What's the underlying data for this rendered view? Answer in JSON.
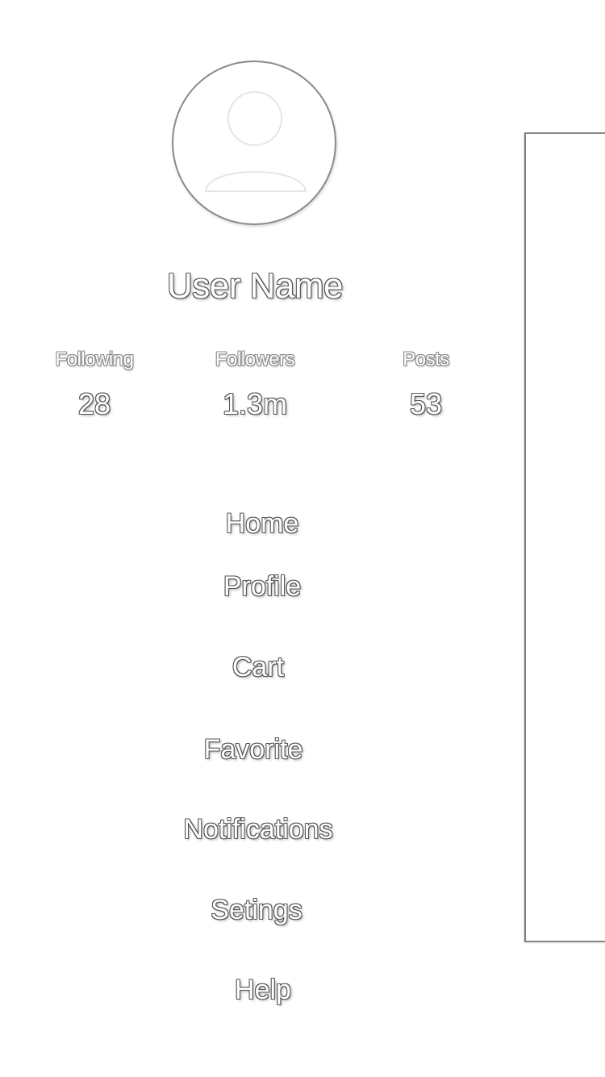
{
  "profile": {
    "user_name": "User Name",
    "avatar_icon": "user-silhouette-icon"
  },
  "stats": [
    {
      "label": "Following",
      "value": "28"
    },
    {
      "label": "Followers",
      "value": "1.3m"
    },
    {
      "label": "Posts",
      "value": "53"
    }
  ],
  "menu": {
    "items": [
      {
        "label": "Home"
      },
      {
        "label": "Profile"
      },
      {
        "label": "Cart"
      },
      {
        "label": "Favorite"
      },
      {
        "label": "Notifications"
      },
      {
        "label": "Setings"
      },
      {
        "label": "Help"
      }
    ]
  },
  "colors": {
    "background": "#ffffff",
    "outline": "#555555",
    "border": "#8a8a8a"
  }
}
